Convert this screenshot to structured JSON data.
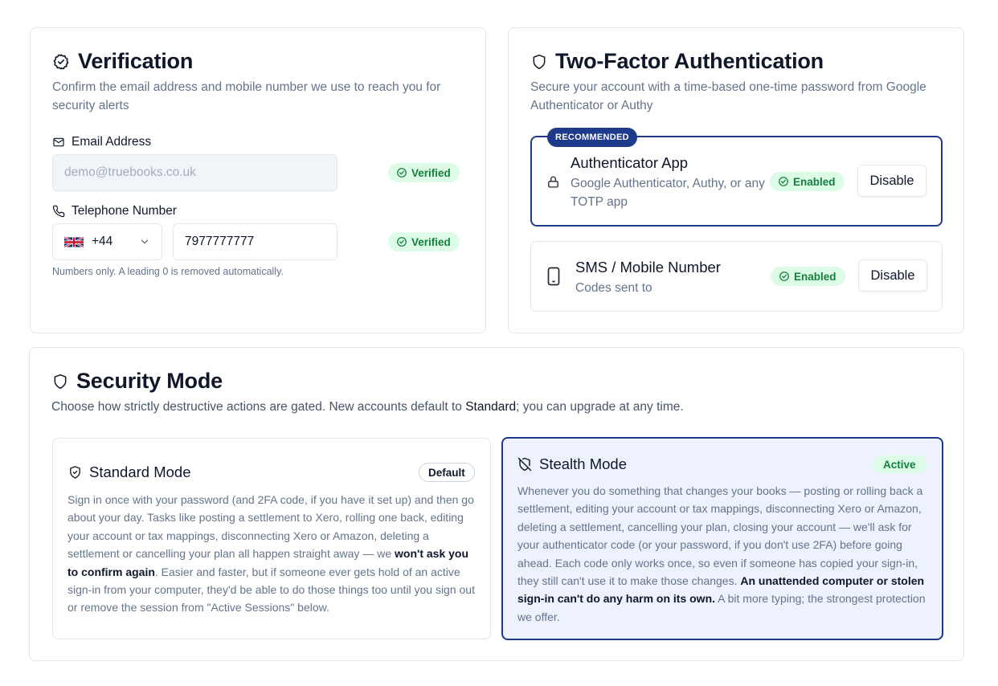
{
  "verification": {
    "title": "Verification",
    "description": "Confirm the email address and mobile number we use to reach you for security alerts",
    "email_label": "Email Address",
    "email_placeholder": "demo@truebooks.co.uk",
    "email_status": "Verified",
    "phone_label": "Telephone Number",
    "country_code": "+44",
    "phone_value": "7977777777",
    "phone_status": "Verified",
    "phone_hint": "Numbers only. A leading 0 is removed automatically."
  },
  "two_factor": {
    "title": "Two-Factor Authentication",
    "description": "Secure your account with a time-based one-time password from Google Authenticator or Authy",
    "recommended_label": "RECOMMENDED",
    "options": [
      {
        "title": "Authenticator App",
        "subtitle": "Google Authenticator, Authy, or any TOTP app",
        "status": "Enabled",
        "action_label": "Disable",
        "icon": "lock-icon"
      },
      {
        "title": "SMS / Mobile Number",
        "subtitle": "Codes sent to",
        "status": "Enabled",
        "action_label": "Disable",
        "icon": "smartphone-icon"
      }
    ]
  },
  "security_mode": {
    "title": "Security Mode",
    "description_prefix": "Choose how strictly destructive actions are gated. New accounts default to ",
    "description_emphasis": "Standard",
    "description_suffix": "; you can upgrade at any time.",
    "standard": {
      "title": "Standard Mode",
      "badge": "Default",
      "body_part1": "Sign in once with your password (and 2FA code, if you have it set up) and then go about your day. Tasks like posting a settlement to Xero, rolling one back, editing your account or tax mappings, disconnecting Xero or Amazon, deleting a settlement or cancelling your plan all happen straight away — we ",
      "body_bold": "won't ask you to confirm again",
      "body_part2": ". Easier and faster, but if someone ever gets hold of an active sign-in from your computer, they'd be able to do those things too until you sign out or remove the session from \"Active Sessions\" below."
    },
    "stealth": {
      "title": "Stealth Mode",
      "badge": "Active",
      "body_part1": "Whenever you do something that changes your books — posting or rolling back a settlement, editing your account or tax mappings, disconnecting Xero or Amazon, deleting a settlement, cancelling your plan, closing your account — we'll ask for your authenticator code (or your password, if you don't use 2FA) before going ahead. Each code only works once, so even if someone has copied your sign-in, they still can't use it to make those changes. ",
      "body_bold": "An unattended computer or stolen sign-in can't do any harm on its own.",
      "body_part2": " A bit more typing; the strongest protection we offer."
    }
  },
  "colors": {
    "accent": "#1e3a8a",
    "success_bg": "#dcfce7",
    "success_text": "#15803d",
    "muted_text": "#64748b",
    "border": "#e2e8f0"
  }
}
